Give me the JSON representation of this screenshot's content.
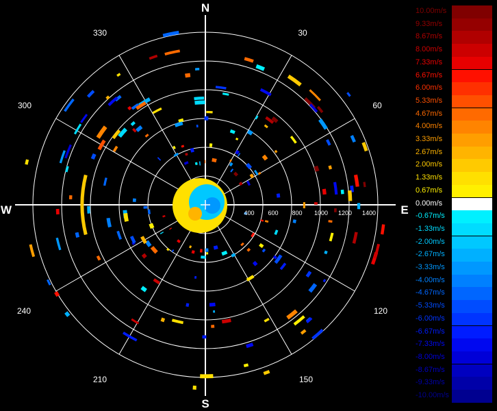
{
  "compass": {
    "north": "N",
    "south": "S",
    "east": "E",
    "west": "W"
  },
  "bearings": [
    "30",
    "60",
    "120",
    "150",
    "210",
    "240",
    "300",
    "330"
  ],
  "range_labels": [
    "400",
    "600",
    "800",
    "1000",
    "1200",
    "1400"
  ],
  "legend": {
    "entries": [
      {
        "label": "10.00m/s",
        "color": "#800000"
      },
      {
        "label": "9.33m/s",
        "color": "#950000"
      },
      {
        "label": "8.67m/s",
        "color": "#b00000"
      },
      {
        "label": "8.00m/s",
        "color": "#cc0000"
      },
      {
        "label": "7.33m/s",
        "color": "#e80000"
      },
      {
        "label": "6.67m/s",
        "color": "#ff1000"
      },
      {
        "label": "6.00m/s",
        "color": "#ff3000"
      },
      {
        "label": "5.33m/s",
        "color": "#ff5000"
      },
      {
        "label": "4.67m/s",
        "color": "#ff6a00"
      },
      {
        "label": "4.00m/s",
        "color": "#ff8400"
      },
      {
        "label": "3.33m/s",
        "color": "#ff9e00"
      },
      {
        "label": "2.67m/s",
        "color": "#ffb400"
      },
      {
        "label": "2.00m/s",
        "color": "#ffca00"
      },
      {
        "label": "1.33m/s",
        "color": "#ffe000"
      },
      {
        "label": "0.67m/s",
        "color": "#fff000"
      },
      {
        "label": "0.00m/s",
        "color": "#ffffff"
      },
      {
        "label": "-0.67m/s",
        "color": "#00f0ff"
      },
      {
        "label": "-1.33m/s",
        "color": "#00dcff"
      },
      {
        "label": "-2.00m/s",
        "color": "#00c8ff"
      },
      {
        "label": "-2.67m/s",
        "color": "#00b0ff"
      },
      {
        "label": "-3.33m/s",
        "color": "#0098ff"
      },
      {
        "label": "-4.00m/s",
        "color": "#0080ff"
      },
      {
        "label": "-4.67m/s",
        "color": "#0066ff"
      },
      {
        "label": "-5.33m/s",
        "color": "#004cff"
      },
      {
        "label": "-6.00m/s",
        "color": "#0034ff"
      },
      {
        "label": "-6.67m/s",
        "color": "#001cff"
      },
      {
        "label": "-7.33m/s",
        "color": "#0008f0"
      },
      {
        "label": "-8.00m/s",
        "color": "#0000d8"
      },
      {
        "label": "-8.67m/s",
        "color": "#0000c0"
      },
      {
        "label": "-9.33m/s",
        "color": "#0000a8"
      },
      {
        "label": "-10.00m/s",
        "color": "#000090"
      }
    ]
  },
  "colors": {
    "grid": "#ffffff",
    "background": "#000000"
  }
}
